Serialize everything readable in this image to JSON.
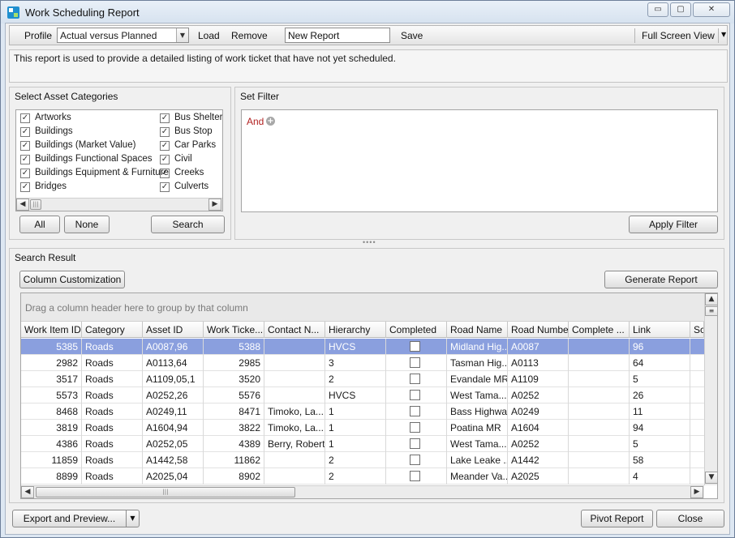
{
  "window": {
    "title": "Work Scheduling Report",
    "controls": {
      "minimize": "▭",
      "maximize": "▢",
      "close": "✕"
    }
  },
  "toolbar": {
    "profile_label": "Profile",
    "profile_value": "Actual versus Planned",
    "load": "Load",
    "remove": "Remove",
    "name_value": "New Report",
    "save": "Save",
    "full_screen": "Full Screen View"
  },
  "description": "This report is used to provide a detailed listing of work ticket that have not yet scheduled.",
  "asset_categories": {
    "title": "Select Asset Categories",
    "items": [
      {
        "label": "Artworks",
        "checked": true
      },
      {
        "label": "Buildings",
        "checked": true
      },
      {
        "label": "Buildings (Market Value)",
        "checked": true
      },
      {
        "label": "Buildings Functional Spaces",
        "checked": true
      },
      {
        "label": "Buildings Equipment & Furniture",
        "checked": true
      },
      {
        "label": "Bridges",
        "checked": true
      },
      {
        "label": "Bus Shelters",
        "checked": true
      },
      {
        "label": "Bus Stop",
        "checked": true
      },
      {
        "label": "Car Parks",
        "checked": true
      },
      {
        "label": "Civil",
        "checked": true
      },
      {
        "label": "Creeks",
        "checked": true
      },
      {
        "label": "Culverts",
        "checked": true
      }
    ],
    "all_button": "All",
    "none_button": "None",
    "search_button": "Search"
  },
  "filter": {
    "title": "Set Filter",
    "operator": "And",
    "apply_button": "Apply Filter"
  },
  "search_result": {
    "title": "Search Result",
    "column_customization": "Column Customization",
    "generate_report": "Generate Report",
    "group_hint": "Drag a column header here to group by that column",
    "columns": [
      "Work Item ID",
      "Category",
      "Asset ID",
      "Work Ticke...",
      "Contact N...",
      "Hierarchy",
      "Completed",
      "Road Name",
      "Road Number",
      "Complete ...",
      "Link",
      "Sc"
    ],
    "rows": [
      {
        "work_item_id": "5385",
        "category": "Roads",
        "asset_id": "A0087,96",
        "work_ticket": "5388",
        "contact": "",
        "hierarchy": "HVCS",
        "completed": false,
        "road_name": "Midland Hig...",
        "road_number": "A0087",
        "complete": "",
        "link": "96"
      },
      {
        "work_item_id": "2982",
        "category": "Roads",
        "asset_id": "A0113,64",
        "work_ticket": "2985",
        "contact": "",
        "hierarchy": "3",
        "completed": false,
        "road_name": "Tasman Hig...",
        "road_number": "A0113",
        "complete": "",
        "link": "64"
      },
      {
        "work_item_id": "3517",
        "category": "Roads",
        "asset_id": "A1109,05,1",
        "work_ticket": "3520",
        "contact": "",
        "hierarchy": "2",
        "completed": false,
        "road_name": "Evandale MR",
        "road_number": "A1109",
        "complete": "",
        "link": "5"
      },
      {
        "work_item_id": "5573",
        "category": "Roads",
        "asset_id": "A0252,26",
        "work_ticket": "5576",
        "contact": "",
        "hierarchy": "HVCS",
        "completed": false,
        "road_name": "West Tama...",
        "road_number": "A0252",
        "complete": "",
        "link": "26"
      },
      {
        "work_item_id": "8468",
        "category": "Roads",
        "asset_id": "A0249,11",
        "work_ticket": "8471",
        "contact": "Timoko, La...",
        "hierarchy": "1",
        "completed": false,
        "road_name": "Bass Highway",
        "road_number": "A0249",
        "complete": "",
        "link": "11"
      },
      {
        "work_item_id": "3819",
        "category": "Roads",
        "asset_id": "A1604,94",
        "work_ticket": "3822",
        "contact": "Timoko, La...",
        "hierarchy": "1",
        "completed": false,
        "road_name": "Poatina MR",
        "road_number": "A1604",
        "complete": "",
        "link": "94"
      },
      {
        "work_item_id": "4386",
        "category": "Roads",
        "asset_id": "A0252,05",
        "work_ticket": "4389",
        "contact": "Berry, Robert",
        "hierarchy": "1",
        "completed": false,
        "road_name": "West Tama...",
        "road_number": "A0252",
        "complete": "",
        "link": "5"
      },
      {
        "work_item_id": "11859",
        "category": "Roads",
        "asset_id": "A1442,58",
        "work_ticket": "11862",
        "contact": "",
        "hierarchy": "2",
        "completed": false,
        "road_name": "Lake Leake ...",
        "road_number": "A1442",
        "complete": "",
        "link": "58"
      },
      {
        "work_item_id": "8899",
        "category": "Roads",
        "asset_id": "A2025,04",
        "work_ticket": "8902",
        "contact": "",
        "hierarchy": "2",
        "completed": false,
        "road_name": "Meander Va...",
        "road_number": "A2025",
        "complete": "",
        "link": "4"
      }
    ]
  },
  "footer": {
    "export": "Export and Preview...",
    "pivot": "Pivot Report",
    "close": "Close"
  },
  "colors": {
    "selected_row": "#8a9fde",
    "filter_operator": "#b22222"
  }
}
